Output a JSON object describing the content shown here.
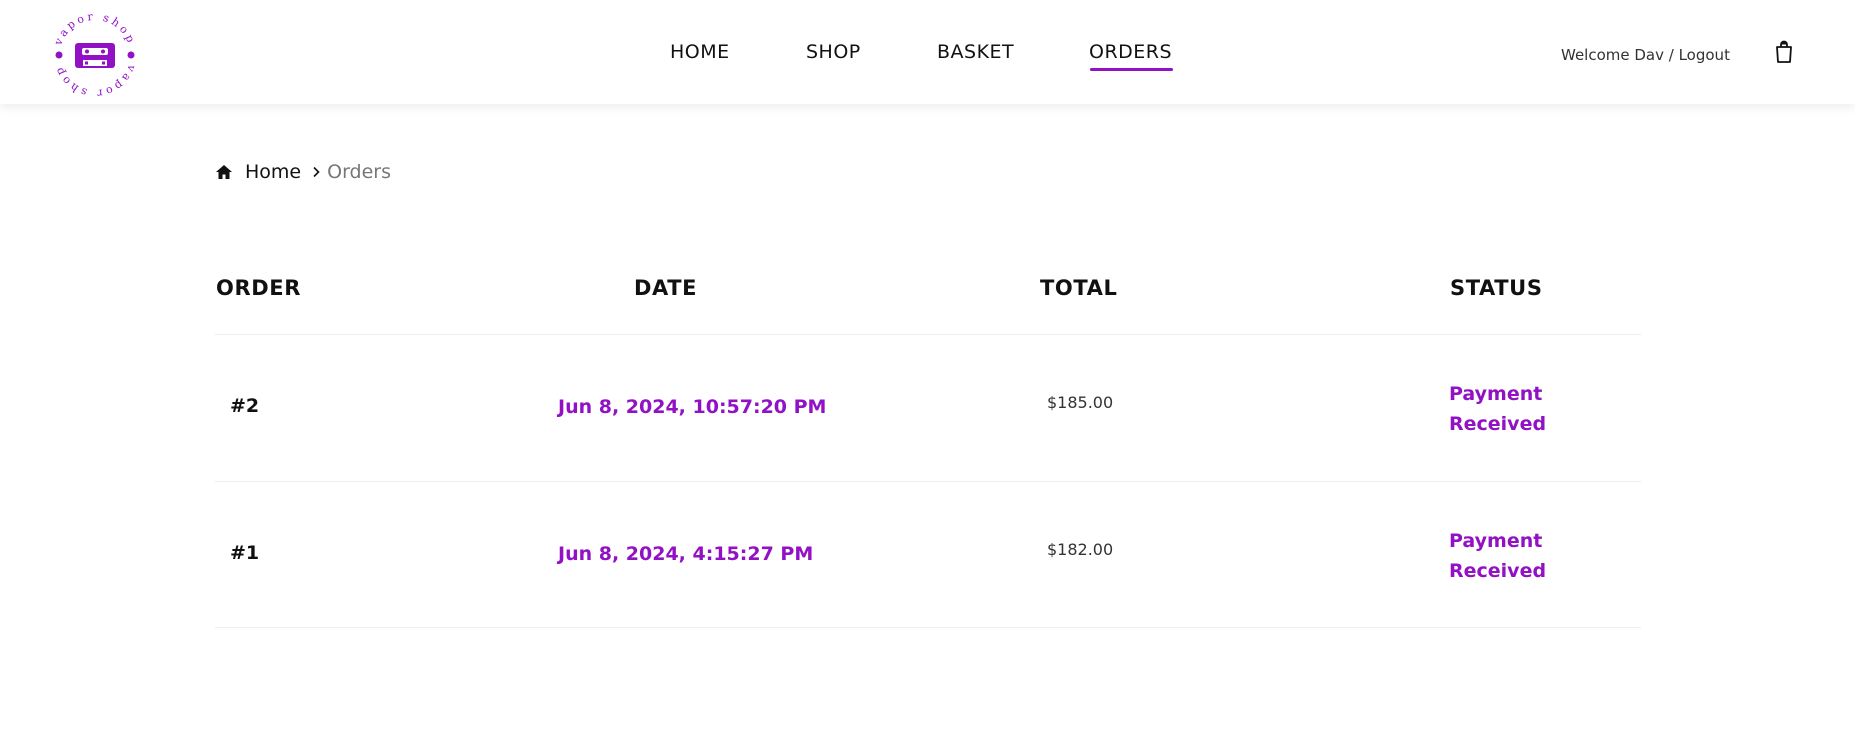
{
  "brand": {
    "logo_text": "vapor shop",
    "accent_color": "#9211c4",
    "logo_icon": "cassette-tape-icon"
  },
  "nav": {
    "items": [
      {
        "label": "HOME"
      },
      {
        "label": "SHOP"
      },
      {
        "label": "BASKET"
      },
      {
        "label": "ORDERS",
        "active": true
      }
    ],
    "welcome_text": "Welcome Dav / Logout",
    "basket_icon": "shopping-bag-icon"
  },
  "breadcrumb": {
    "home_icon": "home-icon",
    "home_label": "Home",
    "separator_icon": "chevron-right-icon",
    "current_label": "Orders"
  },
  "orders_table": {
    "columns": [
      "ORDER",
      "DATE",
      "TOTAL",
      "STATUS"
    ],
    "rows": [
      {
        "order": "#2",
        "date": "Jun 8, 2024, 10:57:20 PM",
        "total": "$185.00",
        "status": "Payment Received"
      },
      {
        "order": "#1",
        "date": "Jun 8, 2024, 4:15:27 PM",
        "total": "$182.00",
        "status": "Payment Received"
      }
    ]
  }
}
